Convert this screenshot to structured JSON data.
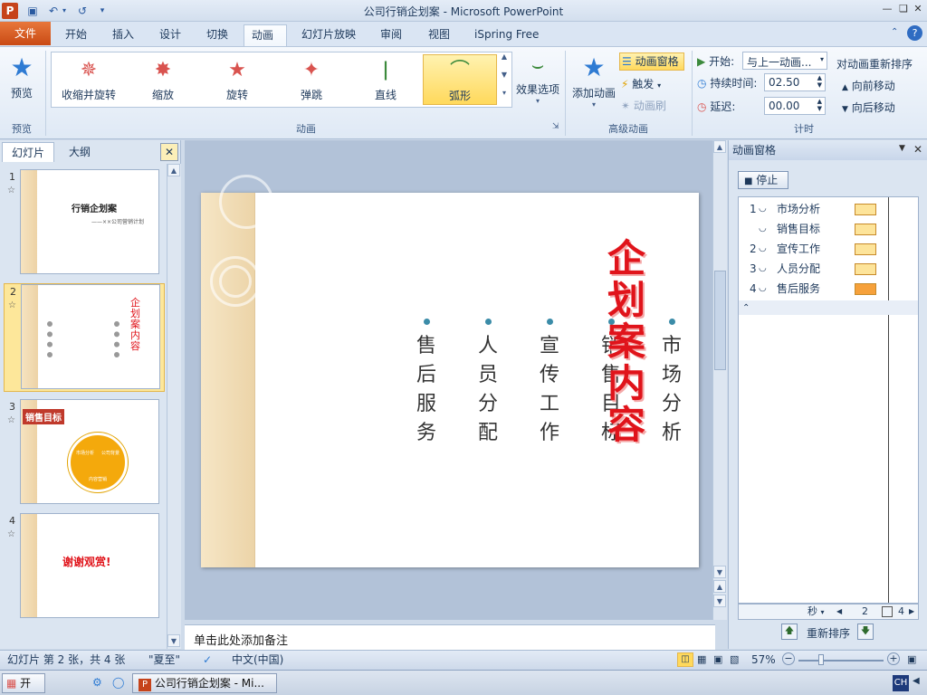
{
  "window": {
    "title": "公司行销企划案 - Microsoft PowerPoint",
    "app_icon": "P"
  },
  "ribbon_tabs": {
    "file": "文件",
    "tabs": [
      "开始",
      "插入",
      "设计",
      "切换",
      "动画",
      "幻灯片放映",
      "审阅",
      "视图",
      "iSpring Free"
    ],
    "active": "动画"
  },
  "ribbon": {
    "preview_label": "预览",
    "preview_group": "预览",
    "animation_group": "动画",
    "advanced_group": "高级动画",
    "timing_group": "计时",
    "gallery": [
      {
        "label": "收缩并旋转",
        "icon": "shrink-turn-icon"
      },
      {
        "label": "缩放",
        "icon": "zoom-icon"
      },
      {
        "label": "旋转",
        "icon": "spin-icon"
      },
      {
        "label": "弹跳",
        "icon": "bounce-icon"
      },
      {
        "label": "直线",
        "icon": "line-path-icon"
      },
      {
        "label": "弧形",
        "icon": "arc-path-icon"
      }
    ],
    "effect_options": "效果选项",
    "add_animation": "添加动画",
    "animation_pane": "动画窗格",
    "trigger": "触发",
    "animation_painter": "动画刷",
    "start_label": "开始:",
    "start_value": "与上一动画...",
    "duration_label": "持续时间:",
    "duration_value": "02.50",
    "delay_label": "延迟:",
    "delay_value": "00.00",
    "reorder_title": "对动画重新排序",
    "move_earlier": "向前移动",
    "move_later": "向后移动"
  },
  "left_pane": {
    "tabs": [
      "幻灯片",
      "大纲"
    ],
    "thumbs": [
      {
        "num": "1",
        "title": "行销企划案",
        "sub": "——××公司营销计划"
      },
      {
        "num": "2",
        "title": "企划案内容"
      },
      {
        "num": "3",
        "title": "销售目标",
        "seg": [
          "市场分析",
          "公司背景",
          "内容营销"
        ]
      },
      {
        "num": "4",
        "title": "谢谢观赏!"
      }
    ]
  },
  "slide": {
    "title": "企划案内容",
    "items": [
      "售后服务",
      "人员分配",
      "宣传工作",
      "销售目标",
      "市场分析"
    ]
  },
  "notes_placeholder": "单击此处添加备注",
  "anim_pane": {
    "title": "动画窗格",
    "stop_button": "停止",
    "items": [
      {
        "num": "1",
        "label": "市场分析"
      },
      {
        "num": "",
        "label": "销售目标"
      },
      {
        "num": "2",
        "label": "宣传工作"
      },
      {
        "num": "3",
        "label": "人员分配"
      },
      {
        "num": "4",
        "label": "售后服务"
      }
    ],
    "seconds_label": "秒",
    "timeline_2": "2",
    "timeline_4": "4",
    "reorder_label": "重新排序"
  },
  "status": {
    "slide_info": "幻灯片 第 2 张，共 4 张",
    "theme": "\"夏至\"",
    "language": "中文(中国)",
    "zoom": "57%"
  },
  "taskbar": {
    "start": "开始",
    "task": "公司行销企划案 - Mi...",
    "ime": "CH"
  },
  "colors": {
    "accent_red": "#e0141b",
    "file_tab": "#d35a22",
    "selected_gallery": "#ffd95c"
  }
}
